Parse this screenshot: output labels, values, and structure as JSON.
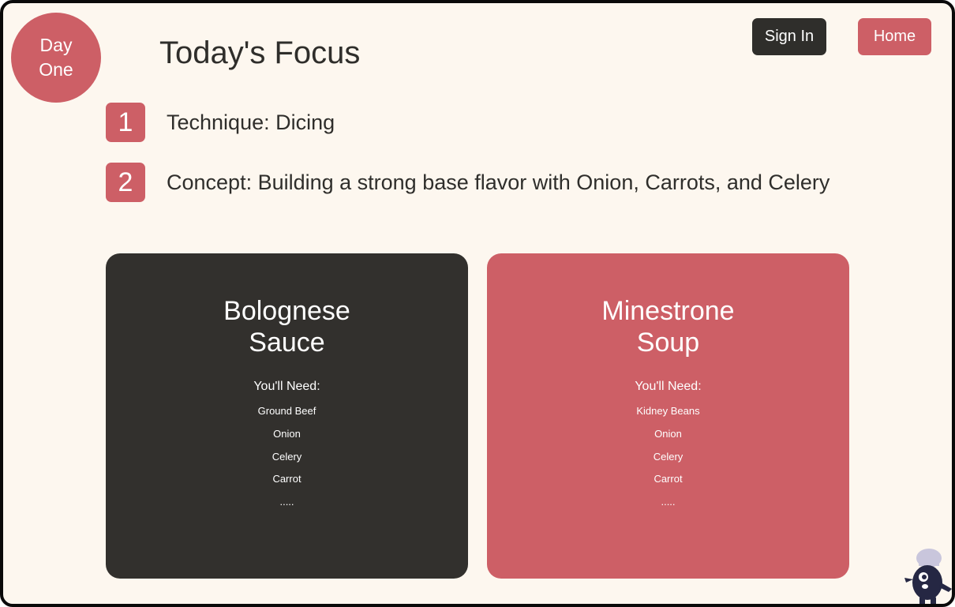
{
  "badge": {
    "line1": "Day",
    "line2": "One"
  },
  "header": {
    "title": "Today's Focus",
    "sign_in_label": "Sign In",
    "home_label": "Home"
  },
  "focus": [
    {
      "number": "1",
      "text": "Technique: Dicing"
    },
    {
      "number": "2",
      "text": "Concept: Building a strong base flavor with Onion, Carrots, and Celery"
    }
  ],
  "recipes": [
    {
      "title": "Bolognese Sauce",
      "need_label": "You'll Need:",
      "ingredients": [
        "Ground Beef",
        "Onion",
        "Celery",
        "Carrot",
        "....."
      ]
    },
    {
      "title": "Minestrone Soup",
      "need_label": "You'll Need:",
      "ingredients": [
        "Kidney Beans",
        "Onion",
        "Celery",
        "Carrot",
        "....."
      ]
    }
  ],
  "icons": {
    "mascot": "chef-mascot-icon"
  },
  "colors": {
    "accent": "#cd5f66",
    "dark": "#32302d",
    "background": "#fdf7ef"
  }
}
